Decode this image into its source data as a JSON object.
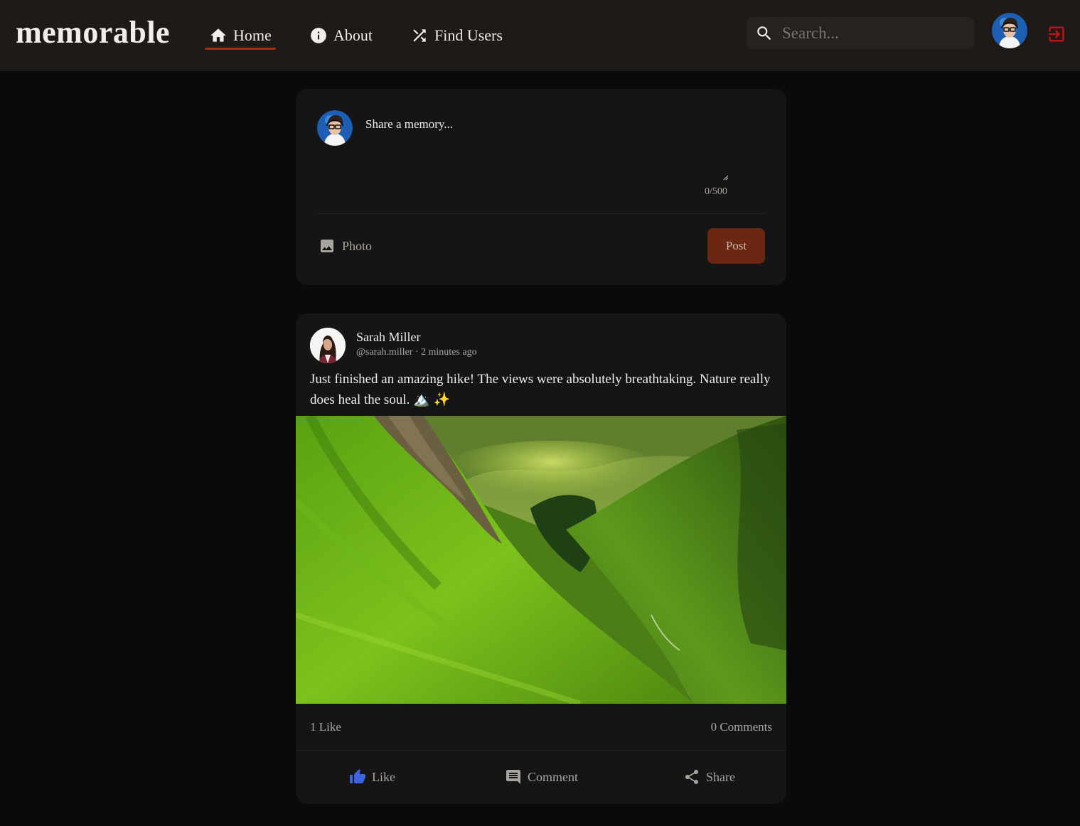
{
  "app": {
    "brand": "memorable"
  },
  "nav": {
    "items": [
      {
        "label": "Home",
        "icon": "home-icon",
        "active": true
      },
      {
        "label": "About",
        "icon": "info-icon"
      },
      {
        "label": "Find Users",
        "icon": "shuffle-icon"
      }
    ],
    "search_placeholder": "Search...",
    "logout_icon": "logout-icon"
  },
  "composer": {
    "placeholder": "Share a memory...",
    "char_count": "0/500",
    "photo_label": "Photo",
    "post_label": "Post"
  },
  "post": {
    "author_name": "Sarah Miller",
    "meta": "@sarah.miller · 2 minutes ago",
    "text": "Just finished an amazing hike! The views were absolutely breathtaking. Nature really does heal the soul. 🏔️ ✨",
    "likes": "1 Like",
    "comments": "0 Comments",
    "actions": {
      "like": "Like",
      "comment": "Comment",
      "share": "Share"
    }
  },
  "colors": {
    "accent": "#a0320f",
    "post_button": "#6b2712",
    "like_icon": "#3b63e0",
    "logout": "#c4121a"
  }
}
